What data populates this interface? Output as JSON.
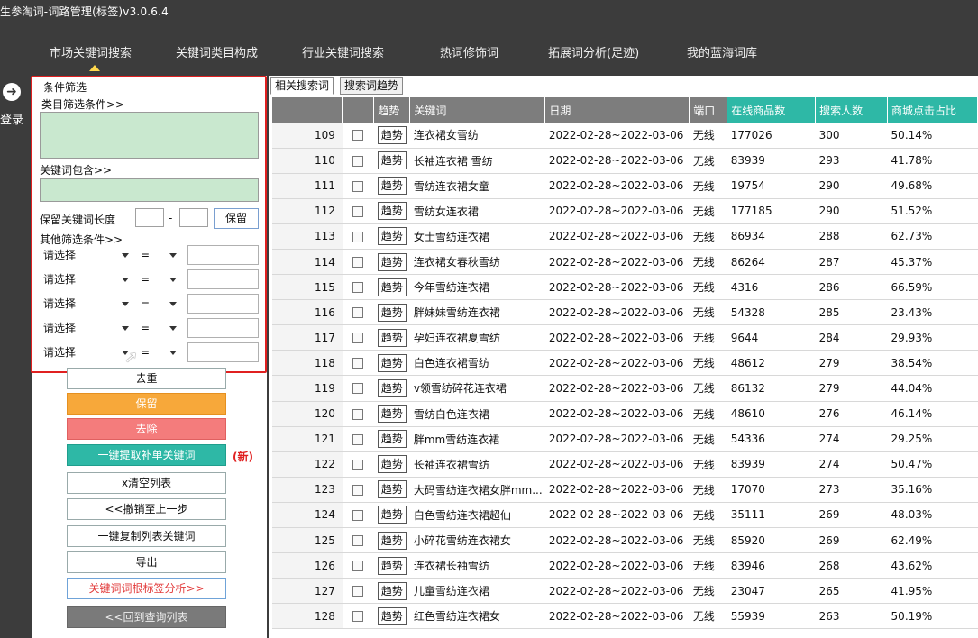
{
  "window": {
    "title": "生参淘词-词路管理(标签)v3.0.6.4"
  },
  "nav": {
    "tabs": [
      "市场关键词搜索",
      "关键词类目构成",
      "行业关键词搜索",
      "热词修饰词",
      "拓展词分析(足迹)",
      "我的蓝海词库"
    ],
    "active": 0
  },
  "login": {
    "label": "登录"
  },
  "filter": {
    "title": "条件筛选",
    "category_label": "类目筛选条件>>",
    "keyword_contains_label": "关键词包含>>",
    "keep_length_label": "保留关键词长度",
    "dash": "-",
    "keep_button": "保留",
    "other_label": "其他筛选条件>>",
    "rows": [
      {
        "select": "请选择",
        "op": "="
      },
      {
        "select": "请选择",
        "op": "="
      },
      {
        "select": "请选择",
        "op": "="
      },
      {
        "select": "请选择",
        "op": "="
      },
      {
        "select": "请选择",
        "op": "="
      }
    ]
  },
  "actions": {
    "dedupe": "去重",
    "keep": "保留",
    "remove": "去除",
    "extract": "一键提取补单关键词",
    "new_tag": "(新)",
    "clear": "x清空列表",
    "undo": "<<撤销至上一步",
    "copy": "一键复制列表关键词",
    "export": "导出",
    "analyze": "关键词词根标签分析>>",
    "back": "<<回到查询列表"
  },
  "subtabs": [
    "相关搜索词",
    "搜索词趋势"
  ],
  "table": {
    "headers": [
      "",
      "",
      "趋势",
      "关键词",
      "日期",
      "端口",
      "在线商品数",
      "搜索人数",
      "商城点击占比"
    ],
    "trend_label": "趋势",
    "rows": [
      [
        "109",
        "连衣裙女雪纺",
        "2022-02-28~2022-03-06",
        "无线",
        "177026",
        "300",
        "50.14%"
      ],
      [
        "110",
        "长袖连衣裙 雪纺",
        "2022-02-28~2022-03-06",
        "无线",
        "83939",
        "293",
        "41.78%"
      ],
      [
        "111",
        "雪纺连衣裙女童",
        "2022-02-28~2022-03-06",
        "无线",
        "19754",
        "290",
        "49.68%"
      ],
      [
        "112",
        "雪纺女连衣裙",
        "2022-02-28~2022-03-06",
        "无线",
        "177185",
        "290",
        "51.52%"
      ],
      [
        "113",
        "女士雪纺连衣裙",
        "2022-02-28~2022-03-06",
        "无线",
        "86934",
        "288",
        "62.73%"
      ],
      [
        "114",
        "连衣裙女春秋雪纺",
        "2022-02-28~2022-03-06",
        "无线",
        "86264",
        "287",
        "45.37%"
      ],
      [
        "115",
        "今年雪纺连衣裙",
        "2022-02-28~2022-03-06",
        "无线",
        "4316",
        "286",
        "66.59%"
      ],
      [
        "116",
        "胖妹妹雪纺连衣裙",
        "2022-02-28~2022-03-06",
        "无线",
        "54328",
        "285",
        "23.43%"
      ],
      [
        "117",
        "孕妇连衣裙夏雪纺",
        "2022-02-28~2022-03-06",
        "无线",
        "9644",
        "284",
        "29.93%"
      ],
      [
        "118",
        "白色连衣裙雪纺",
        "2022-02-28~2022-03-06",
        "无线",
        "48612",
        "279",
        "38.54%"
      ],
      [
        "119",
        "v领雪纺碎花连衣裙",
        "2022-02-28~2022-03-06",
        "无线",
        "86132",
        "279",
        "44.04%"
      ],
      [
        "120",
        "雪纺白色连衣裙",
        "2022-02-28~2022-03-06",
        "无线",
        "48610",
        "276",
        "46.14%"
      ],
      [
        "121",
        "胖mm雪纺连衣裙",
        "2022-02-28~2022-03-06",
        "无线",
        "54336",
        "274",
        "29.25%"
      ],
      [
        "122",
        "长袖连衣裙雪纺",
        "2022-02-28~2022-03-06",
        "无线",
        "83939",
        "274",
        "50.47%"
      ],
      [
        "123",
        "大码雪纺连衣裙女胖mm...",
        "2022-02-28~2022-03-06",
        "无线",
        "17070",
        "273",
        "35.16%"
      ],
      [
        "124",
        "白色雪纺连衣裙超仙",
        "2022-02-28~2022-03-06",
        "无线",
        "35111",
        "269",
        "48.03%"
      ],
      [
        "125",
        "小碎花雪纺连衣裙女",
        "2022-02-28~2022-03-06",
        "无线",
        "85920",
        "269",
        "62.49%"
      ],
      [
        "126",
        "连衣裙长袖雪纺",
        "2022-02-28~2022-03-06",
        "无线",
        "83946",
        "268",
        "43.62%"
      ],
      [
        "127",
        "儿童雪纺连衣裙",
        "2022-02-28~2022-03-06",
        "无线",
        "23047",
        "265",
        "41.95%"
      ],
      [
        "128",
        "红色雪纺连衣裙女",
        "2022-02-28~2022-03-06",
        "无线",
        "55939",
        "263",
        "50.19%"
      ]
    ]
  },
  "colors": {
    "highlight_border": "#e02020",
    "accent_green": "#2eb8a6",
    "accent_orange": "#f7a83a",
    "accent_red": "#f47c7c"
  }
}
